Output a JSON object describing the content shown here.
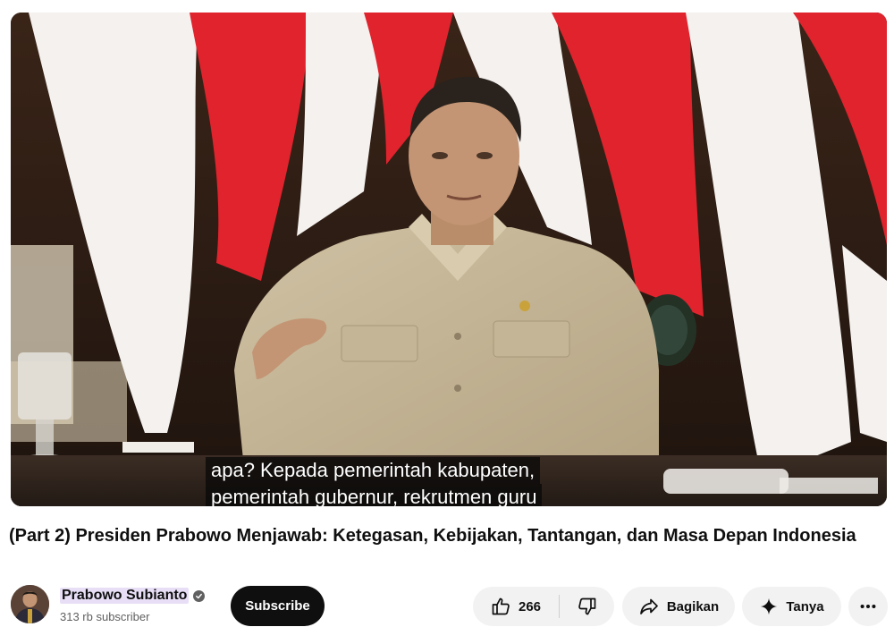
{
  "video": {
    "captions": [
      "apa? Kepada pemerintah kabupaten,",
      "pemerintah gubernur, rekrutmen guru"
    ]
  },
  "title": "(Part 2) Presiden Prabowo Menjawab: Ketegasan, Kebijakan, Tantangan, dan Masa Depan Indonesia",
  "channel": {
    "name": "Prabowo Subianto",
    "verified_icon": "verified-check-icon",
    "subscribers": "313 rb subscriber",
    "subscribe_label": "Subscribe"
  },
  "actions": {
    "like_count": "266",
    "like_icon": "thumbs-up-icon",
    "dislike_icon": "thumbs-down-icon",
    "share_label": "Bagikan",
    "share_icon": "share-arrow-icon",
    "ask_label": "Tanya",
    "ask_icon": "sparkle-icon",
    "more_icon": "more-horizontal-icon"
  },
  "colors": {
    "flag_red": "#e0232d",
    "flag_white": "#f4f1ee",
    "subscribe_bg": "#0f0f0f",
    "pill_bg": "#f2f2f2",
    "channel_highlight": "#e8dff6"
  }
}
